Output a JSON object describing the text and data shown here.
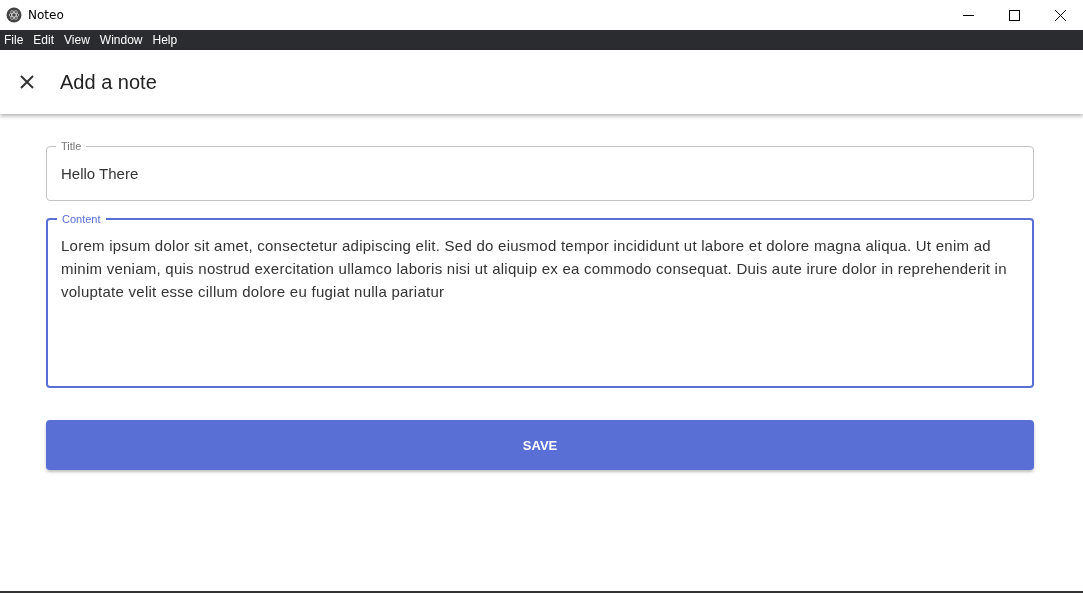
{
  "window": {
    "title": "Noteo"
  },
  "menu": [
    "File",
    "Edit",
    "View",
    "Window",
    "Help"
  ],
  "header": {
    "title": "Add a note"
  },
  "fields": [
    {
      "kind": "single",
      "label": "Title",
      "value": "Hello There",
      "focused": false
    },
    {
      "kind": "multiline",
      "label": "Content",
      "value": "Lorem ipsum dolor sit amet, consectetur adipiscing elit. Sed do eiusmod tempor incididunt ut labore et dolore magna aliqua. Ut enim ad minim veniam, quis nostrud exercitation ullamco laboris nisi ut aliquip ex ea commodo consequat. Duis aute irure dolor in reprehenderit in voluptate velit esse cillum dolore eu fugiat nulla pariatur",
      "focused": true
    }
  ],
  "save_button": "SAVE"
}
